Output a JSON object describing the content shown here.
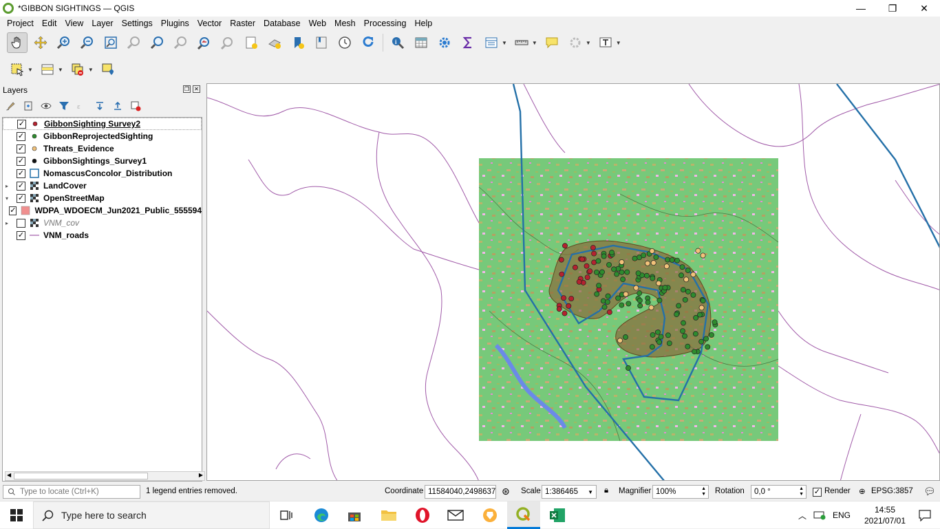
{
  "window": {
    "title": "*GIBBON SIGHTINGS — QGIS",
    "minimize": "—",
    "restore": "❐",
    "close": "✕"
  },
  "menu": [
    "Project",
    "Edit",
    "View",
    "Layer",
    "Settings",
    "Plugins",
    "Vector",
    "Raster",
    "Database",
    "Web",
    "Mesh",
    "Processing",
    "Help"
  ],
  "layers_panel": {
    "title": "Layers",
    "layers": [
      {
        "name": "GibbonSighting Survey2",
        "checked": true,
        "symbol": "point",
        "color": "#b5222f",
        "expander": "",
        "style": "normal"
      },
      {
        "name": "GibbonReprojectedSighting",
        "checked": true,
        "symbol": "point",
        "color": "#2e8b2e",
        "expander": "",
        "style": "normal"
      },
      {
        "name": "Threats_Evidence",
        "checked": true,
        "symbol": "point",
        "color": "#f2c27a",
        "expander": "",
        "style": "normal"
      },
      {
        "name": "GibbonSightings_Survey1",
        "checked": true,
        "symbol": "point",
        "color": "#111111",
        "expander": "",
        "style": "normal"
      },
      {
        "name": "NomascusConcolor_Distribution",
        "checked": true,
        "symbol": "polygon-outline",
        "color": "#2470a8",
        "expander": "",
        "style": "normal"
      },
      {
        "name": "LandCover",
        "checked": true,
        "symbol": "raster",
        "color": "#333333",
        "expander": "▸",
        "style": "normal"
      },
      {
        "name": "OpenStreetMap",
        "checked": true,
        "symbol": "raster",
        "color": "#333333",
        "expander": "▾",
        "style": "normal"
      },
      {
        "name": "WDPA_WDOECM_Jun2021_Public_555594",
        "checked": true,
        "symbol": "polygon-fill",
        "color": "#f08f8f",
        "expander": "",
        "style": "normal"
      },
      {
        "name": "VNM_cov",
        "checked": false,
        "symbol": "raster",
        "color": "#333333",
        "expander": "▸",
        "style": "italic"
      },
      {
        "name": "VNM_roads",
        "checked": true,
        "symbol": "line",
        "color": "#a05aa8",
        "expander": "",
        "style": "normal"
      }
    ]
  },
  "status": {
    "locate_placeholder": "Type to locate (Ctrl+K)",
    "message": "1 legend entries removed.",
    "coordinate_label": "Coordinate",
    "coordinate": "11584040,2498637",
    "scale_label": "Scale",
    "scale": "1:386465",
    "magnifier_label": "Magnifier",
    "magnifier": "100%",
    "rotation_label": "Rotation",
    "rotation": "0,0 °",
    "render_label": "Render",
    "crs": "EPSG:3857"
  },
  "taskbar": {
    "search": "Type here to search",
    "lang": "ENG",
    "time": "14:55",
    "date": "2021/07/01"
  },
  "colors": {
    "raster_green": "#77c97a",
    "protected_area": "#8a6b3c",
    "distribution": "#2470a8",
    "roads": "#a05aa8"
  }
}
